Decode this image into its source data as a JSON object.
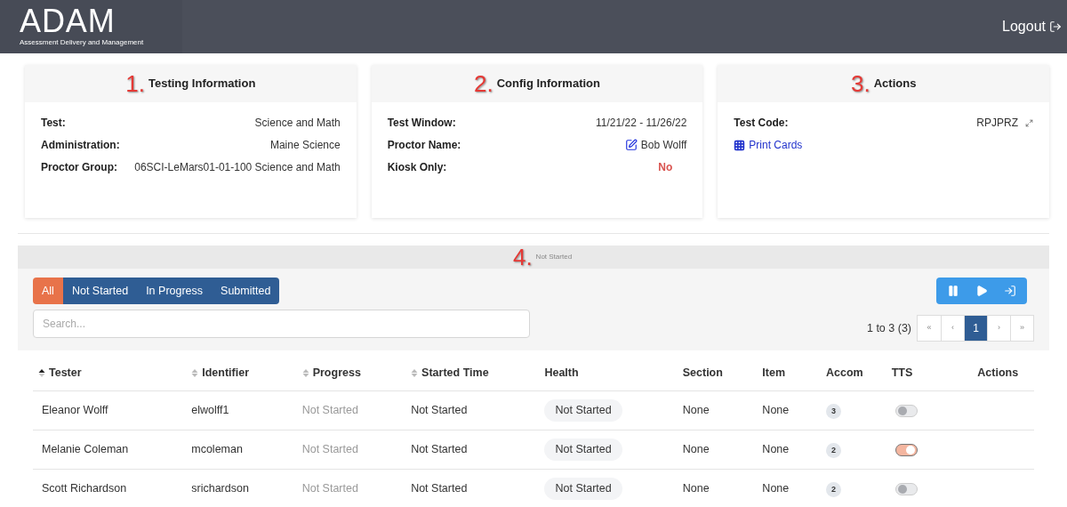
{
  "header": {
    "logo": "ADAM",
    "logo_subtitle": "Assessment Delivery and Management",
    "logout": "Logout"
  },
  "cards": [
    {
      "marker": "1.",
      "title": "Testing Information",
      "rows": [
        {
          "label": "Test:",
          "value": "Science and Math",
          "kind": "text"
        },
        {
          "label": "Administration:",
          "value": "Maine Science",
          "kind": "text"
        },
        {
          "label": "Proctor Group:",
          "value": "06SCI-LeMars01-01-100 Science and Math",
          "kind": "text"
        }
      ]
    },
    {
      "marker": "2.",
      "title": "Config Information",
      "rows": [
        {
          "label": "Test Window:",
          "value": "11/21/22 - 11/26/22",
          "kind": "text"
        },
        {
          "label": "Proctor Name:",
          "value": "Bob Wolff",
          "kind": "editable"
        },
        {
          "label": "Kiosk Only:",
          "value": "No",
          "kind": "alert"
        }
      ]
    },
    {
      "marker": "3.",
      "title": "Actions",
      "rows": [
        {
          "label": "Test Code:",
          "value": "RPJPRZ",
          "kind": "expandable"
        }
      ],
      "link": "Print Cards"
    }
  ],
  "section": {
    "marker": "4.",
    "title": "Not Started"
  },
  "filters": [
    {
      "label": "All",
      "selected": true
    },
    {
      "label": "Not Started",
      "selected": false
    },
    {
      "label": "In Progress",
      "selected": false
    },
    {
      "label": "Submitted",
      "selected": false
    }
  ],
  "search": {
    "placeholder": "Search..."
  },
  "pagination": {
    "range": "1 to 3 (3)",
    "pages": [
      {
        "label": "«",
        "selected": false
      },
      {
        "label": "‹",
        "selected": false
      },
      {
        "label": "1",
        "selected": true
      },
      {
        "label": "›",
        "selected": false
      },
      {
        "label": "»",
        "selected": false
      }
    ]
  },
  "table": {
    "columns": [
      {
        "label": "Tester",
        "kind": "sorted"
      },
      {
        "label": "Identifier",
        "kind": "sortable"
      },
      {
        "label": "Progress",
        "kind": "sortable"
      },
      {
        "label": "Started Time",
        "kind": "sortable"
      },
      {
        "label": "Health",
        "kind": "plain"
      },
      {
        "label": "Section",
        "kind": "plain"
      },
      {
        "label": "Item",
        "kind": "plain"
      },
      {
        "label": "Accom",
        "kind": "plain"
      },
      {
        "label": "TTS",
        "kind": "plain"
      },
      {
        "label": "Actions",
        "kind": "plain"
      }
    ],
    "rows": [
      {
        "tester": "Eleanor Wolff",
        "identifier": "elwolff1",
        "progress": "Not Started",
        "started_time": "Not Started",
        "health": "Not Started",
        "section": "None",
        "item": "None",
        "accom": "3",
        "tts": false
      },
      {
        "tester": "Melanie Coleman",
        "identifier": "mcoleman",
        "progress": "Not Started",
        "started_time": "Not Started",
        "health": "Not Started",
        "section": "None",
        "item": "None",
        "accom": "2",
        "tts": true
      },
      {
        "tester": "Scott Richardson",
        "identifier": "srichardson",
        "progress": "Not Started",
        "started_time": "Not Started",
        "health": "Not Started",
        "section": "None",
        "item": "None",
        "accom": "2",
        "tts": false
      }
    ]
  }
}
